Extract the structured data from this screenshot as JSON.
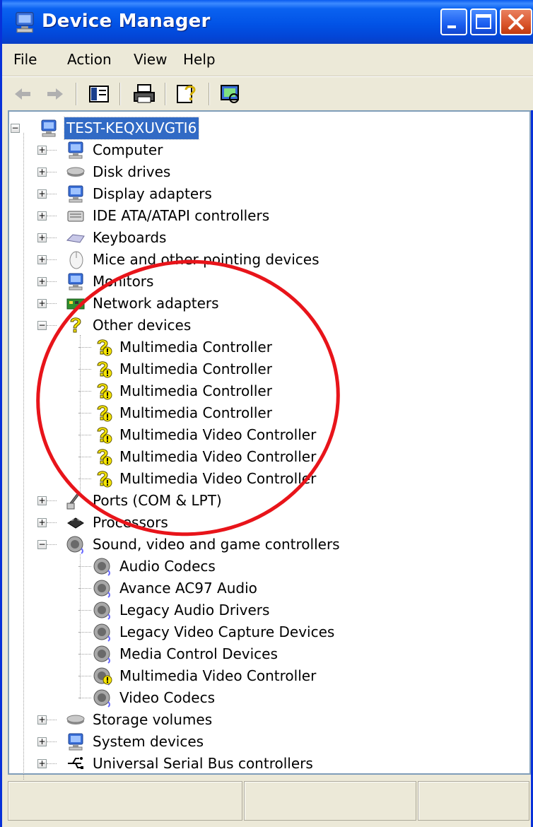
{
  "window": {
    "title": "Device Manager",
    "title_icon": "device-manager-computer-icon"
  },
  "title_buttons": [
    "minimize",
    "maximize",
    "close"
  ],
  "menu": [
    "File",
    "Action",
    "View",
    "Help"
  ],
  "toolbar": [
    "back-arrow-icon",
    "forward-arrow-icon",
    "show-hide-console-tree-icon",
    "print-icon",
    "help-icon",
    "scan-hardware-icon"
  ],
  "tree": {
    "root": "TEST-KEQXUVGTI6",
    "categories": [
      {
        "label": "Computer",
        "icon": "computer-icon"
      },
      {
        "label": "Disk drives",
        "icon": "disk-drive-icon"
      },
      {
        "label": "Display adapters",
        "icon": "display-adapter-icon"
      },
      {
        "label": "IDE ATA/ATAPI controllers",
        "icon": "ide-controller-icon"
      },
      {
        "label": "Keyboards",
        "icon": "keyboard-icon"
      },
      {
        "label": "Mice and other pointing devices",
        "icon": "mouse-icon"
      },
      {
        "label": "Monitors",
        "icon": "monitor-icon"
      },
      {
        "label": "Network adapters",
        "icon": "network-adapter-icon"
      },
      {
        "label": "Other devices",
        "icon": "unknown-device-icon"
      },
      {
        "label": "Ports (COM & LPT)",
        "icon": "port-icon"
      },
      {
        "label": "Processors",
        "icon": "processor-icon"
      },
      {
        "label": "Sound, video and game controllers",
        "icon": "speaker-icon"
      },
      {
        "label": "Storage volumes",
        "icon": "disk-drive-icon"
      },
      {
        "label": "System devices",
        "icon": "computer-icon"
      },
      {
        "label": "Universal Serial Bus controllers",
        "icon": "usb-icon"
      }
    ],
    "other_devices": [
      "Multimedia Controller",
      "Multimedia Controller",
      "Multimedia Controller",
      "Multimedia Controller",
      "Multimedia Video Controller",
      "Multimedia Video Controller",
      "Multimedia Video Controller"
    ],
    "sound_devices": [
      {
        "label": "Audio Codecs",
        "warning": false
      },
      {
        "label": "Avance AC97 Audio",
        "warning": false
      },
      {
        "label": "Legacy Audio Drivers",
        "warning": false
      },
      {
        "label": "Legacy Video Capture Devices",
        "warning": false
      },
      {
        "label": "Media Control Devices",
        "warning": false
      },
      {
        "label": "Multimedia Video Controller",
        "warning": true
      },
      {
        "label": "Video Codecs",
        "warning": false
      }
    ]
  },
  "colors": {
    "titlebar": "#0553e6",
    "selection": "#316ac5",
    "annotation_circle": "#e8141a",
    "warning_yellow": "#f5e400"
  }
}
